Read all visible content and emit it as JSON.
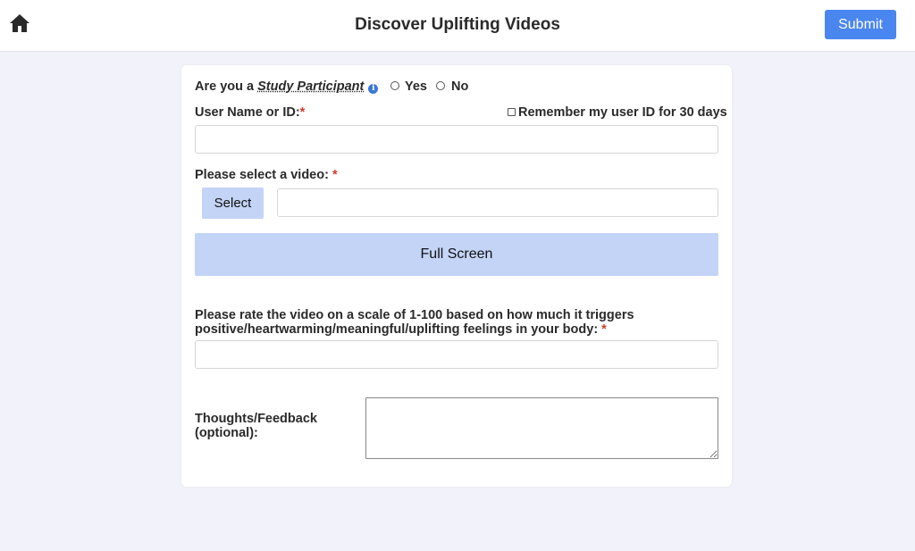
{
  "header": {
    "title": "Discover Uplifting Videos",
    "submit_label": "Submit",
    "home_icon": "home-icon"
  },
  "form": {
    "participant": {
      "prefix": "Are you a ",
      "emphasis": "Study Participant",
      "info_icon": "info-icon",
      "options": [
        "Yes",
        "No"
      ]
    },
    "user_id": {
      "label": "User Name or ID:",
      "required_mark": "*",
      "remember_label": "Remember my user ID for 30 days",
      "value": ""
    },
    "video": {
      "label": "Please select a video: ",
      "required_mark": "*",
      "select_label": "Select",
      "value": "",
      "fullscreen_label": "Full Screen"
    },
    "rating": {
      "label_line1": "Please rate the video on a scale of 1-100 based on how much it triggers",
      "label_line2": "positive/heartwarming/meaningful/uplifting feelings in your body: ",
      "required_mark": "*",
      "value": ""
    },
    "feedback": {
      "label_line1": "Thoughts/Feedback",
      "label_line2": "(optional):",
      "value": ""
    }
  },
  "colors": {
    "accent": "#4a86f0",
    "button_light": "#c3d4f7",
    "background": "#f2f2fa",
    "required": "#d43a2f"
  }
}
